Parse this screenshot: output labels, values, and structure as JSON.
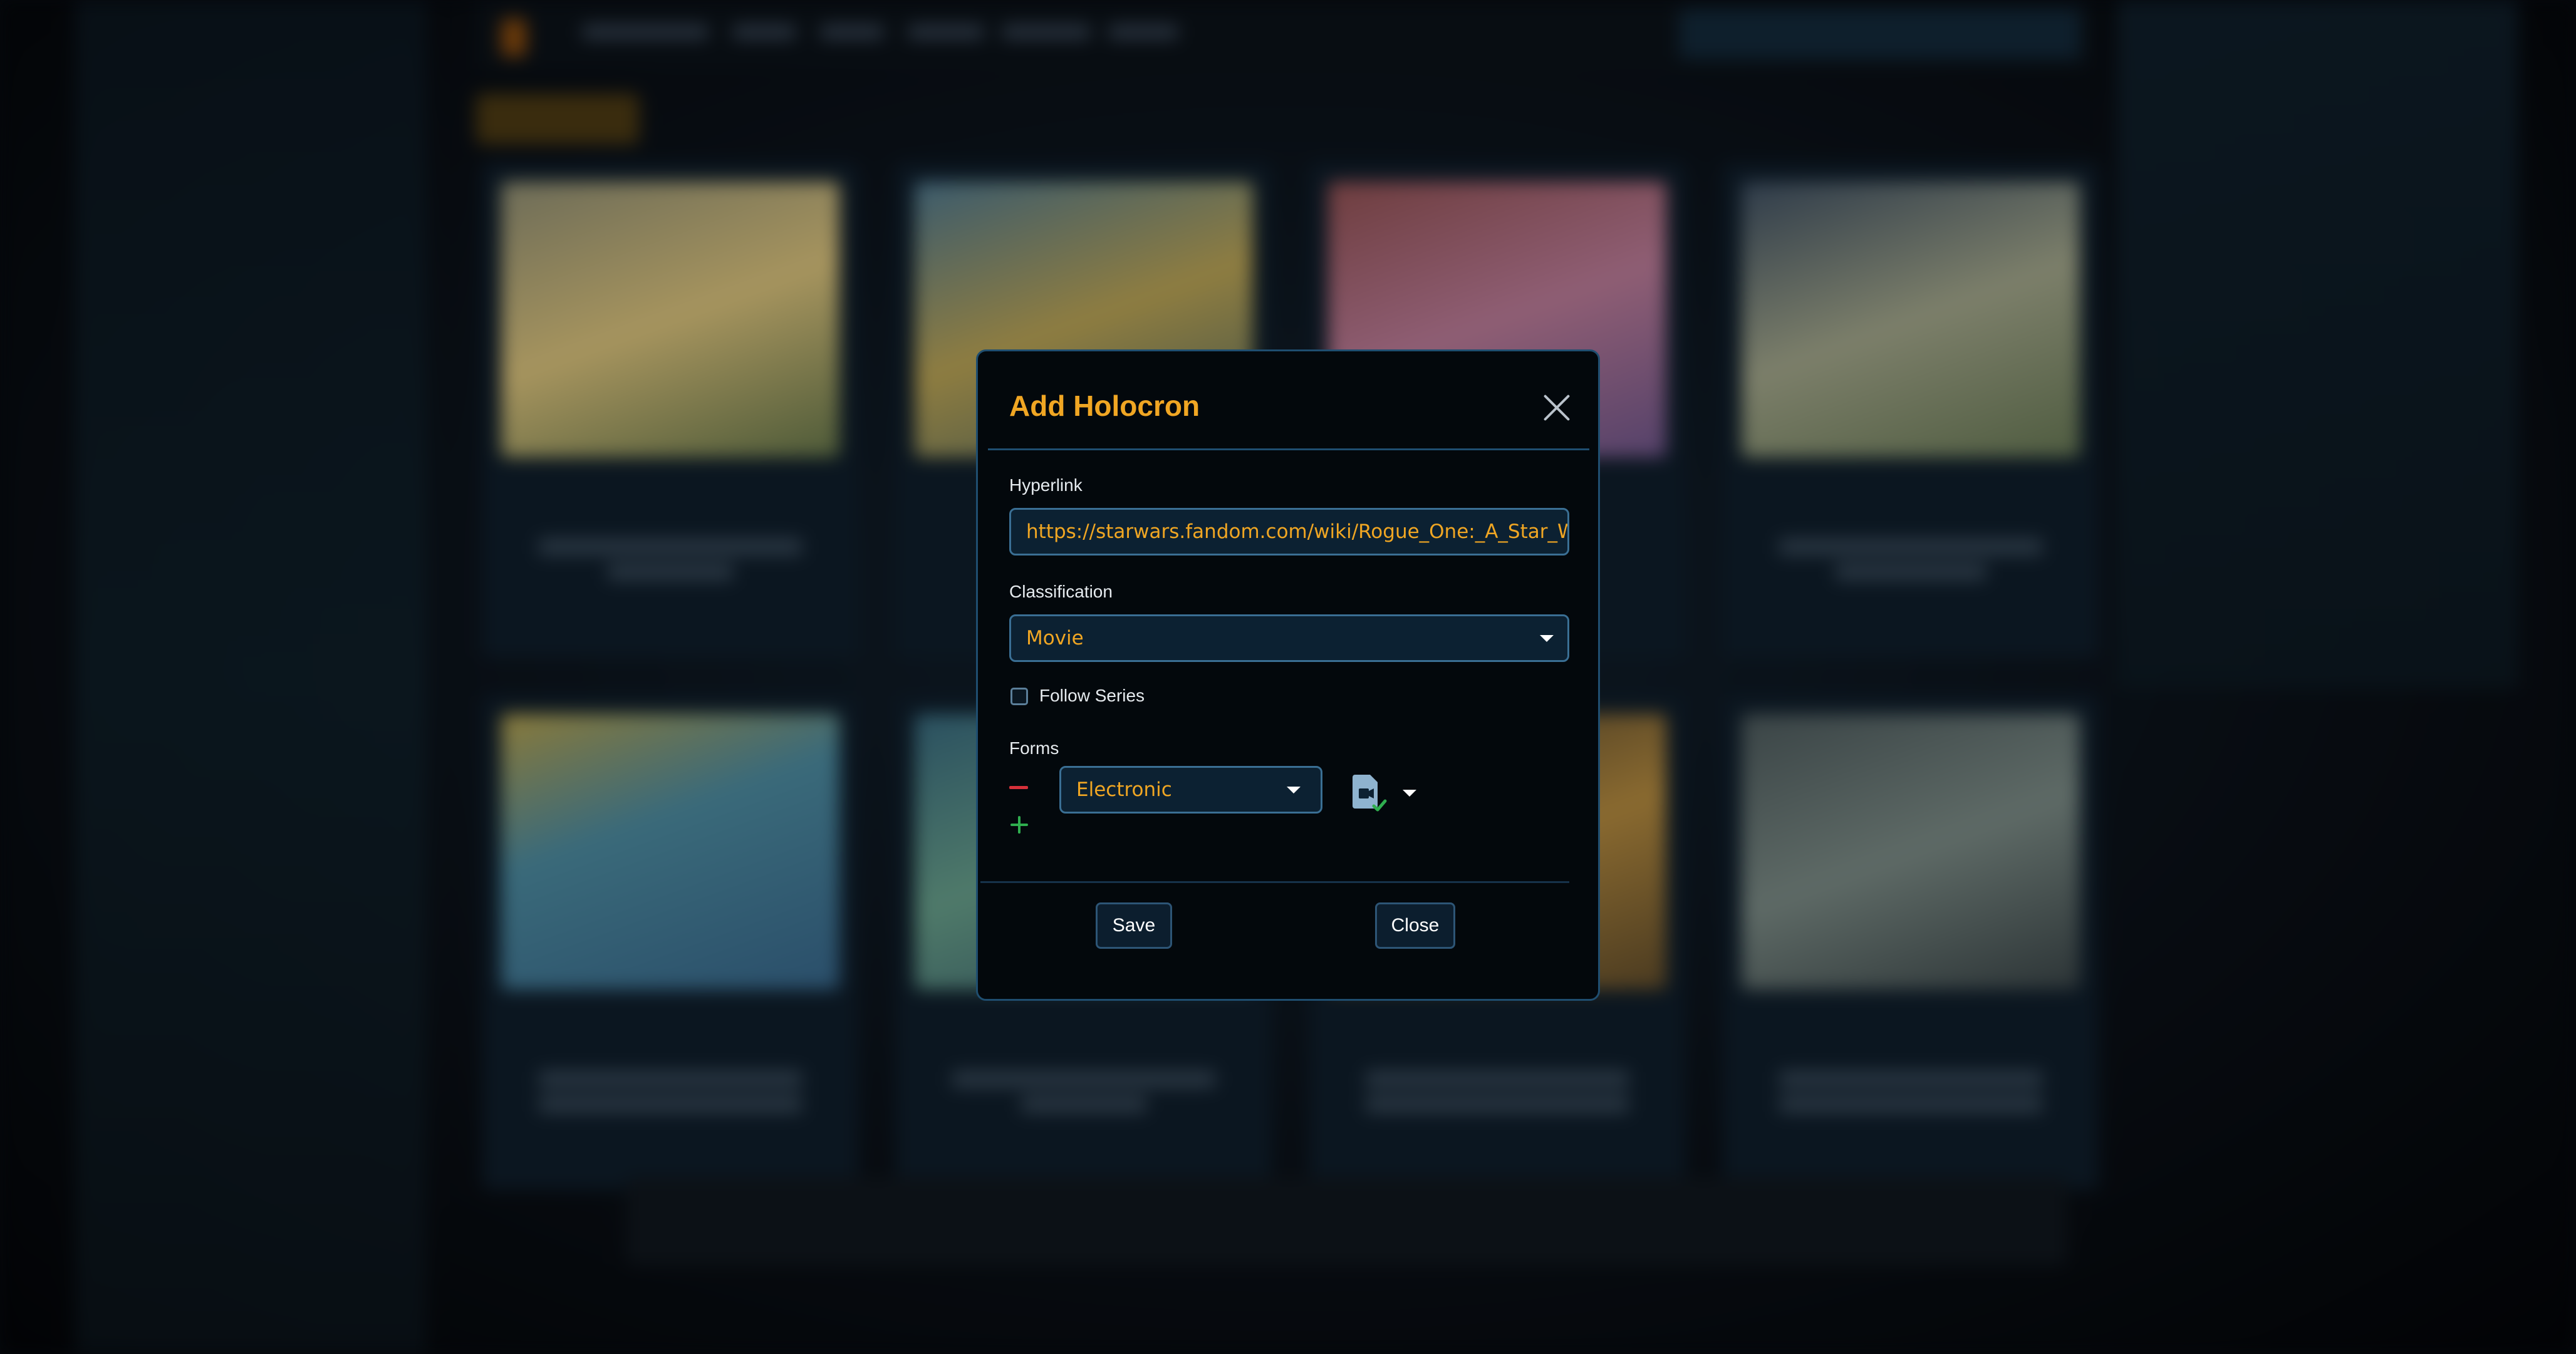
{
  "modal": {
    "title": "Add Holocron",
    "close_icon": "close-icon",
    "hyperlink": {
      "label": "Hyperlink",
      "value": "https://starwars.fandom.com/wiki/Rogue_One:_A_Star_Wars_Story"
    },
    "classification": {
      "label": "Classification",
      "selected": "Movie"
    },
    "follow_series": {
      "label": "Follow Series",
      "checked": false
    },
    "forms": {
      "label": "Forms",
      "items": [
        {
          "selected": "Electronic",
          "remove_icon": "minus-icon",
          "status_icon": "file-check-icon"
        }
      ],
      "add_icon": "plus-icon"
    },
    "buttons": {
      "save": "Save",
      "close": "Close"
    }
  },
  "colors": {
    "accent": "#f0a623",
    "border": "#1f4e70",
    "remove": "#d6303a",
    "add": "#2fae4f",
    "check": "#2fae4f"
  }
}
